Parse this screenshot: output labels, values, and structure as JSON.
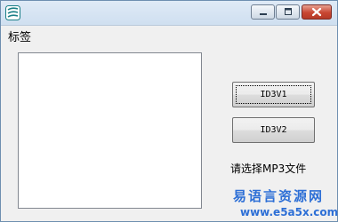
{
  "window": {
    "controls": {
      "minimize_icon": "minimize-icon",
      "maximize_icon": "maximize-icon",
      "close_icon": "close-icon"
    }
  },
  "form": {
    "tag_label": "标签",
    "buttons": {
      "id3v1": "ID3V1",
      "id3v2": "ID3V2"
    },
    "status": "请选择MP3文件"
  },
  "watermark": {
    "site_name": "易语言资源网",
    "url": "www.e5a5x.com"
  },
  "colors": {
    "watermark": "#2d6fd6",
    "close_button": "#c84632"
  }
}
